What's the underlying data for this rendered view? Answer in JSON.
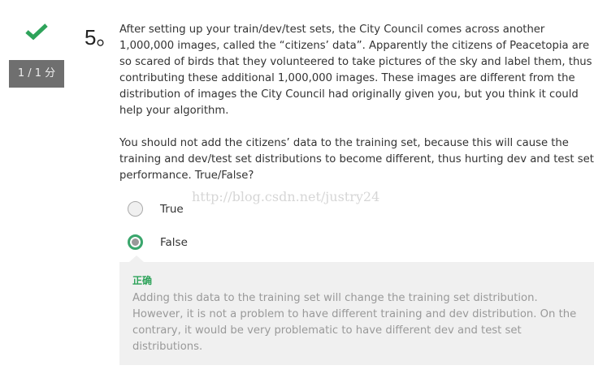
{
  "status_icon": "checkmark-icon",
  "score": "1 / 1 分",
  "question": {
    "number": "5。",
    "paragraphs": [
      "After setting up your train/dev/test sets, the City Council comes across another 1,000,000 images, called the “citizens’ data”. Apparently the citizens of Peacetopia are so scared of birds that they volunteered to take pictures of the sky and label them, thus contributing these additional 1,000,000 images. These images are different from the distribution of images the City Council had originally given you, but you think it could help your algorithm.",
      "You should not add the citizens’ data to the training set, because this will cause the training and dev/test set distributions to become different, thus hurting dev and test set performance. True/False?"
    ]
  },
  "options": [
    {
      "label": "True",
      "selected": false
    },
    {
      "label": "False",
      "selected": true
    }
  ],
  "watermark": "http://blog.csdn.net/justry24",
  "feedback": {
    "status": "正确",
    "explanation": "Adding this data to the training set will change the training set distribution. However, it is not a problem to have different training and dev distribution. On the contrary, it would be very problematic to have different dev and test set distributions."
  },
  "colors": {
    "correct": "#2ea35a",
    "score_bg": "#6f6f6f"
  }
}
